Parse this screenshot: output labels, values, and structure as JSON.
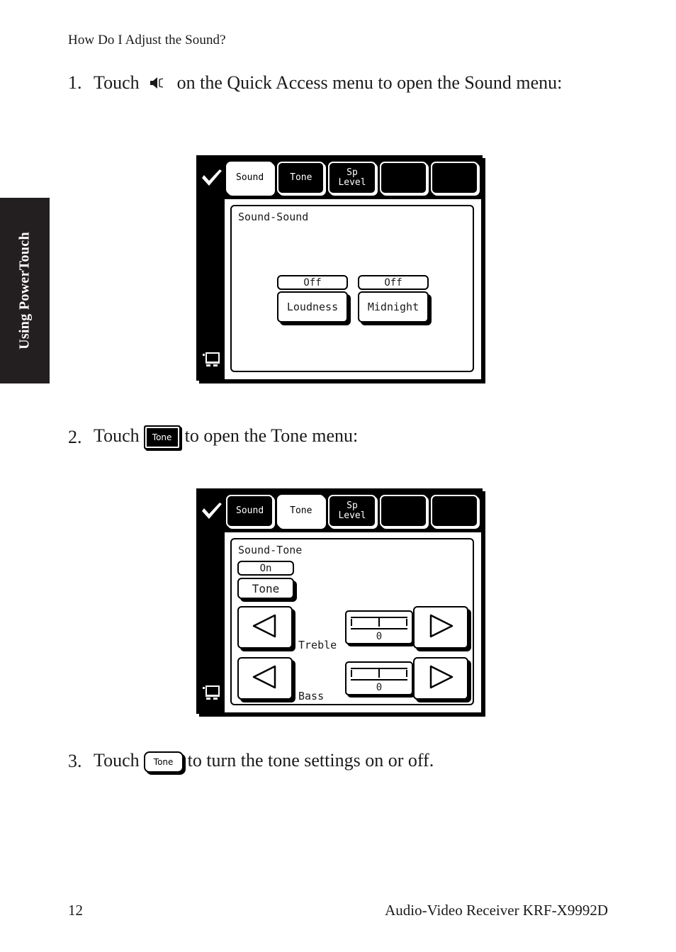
{
  "side_tab": {
    "label": "Using PowerTouch"
  },
  "page_heading": "How Do I Adjust the Sound?",
  "steps": [
    {
      "number": "1.",
      "text_before": "Touch",
      "icon": "speaker-icon",
      "text_after": "on the Quick Access menu to open the Sound menu:"
    },
    {
      "number": "2.",
      "text_before": "Touch",
      "button_label": "Tone",
      "text_after": "to open the Tone menu:"
    },
    {
      "number": "3.",
      "text_before": "Touch",
      "button_label": "Tone",
      "text_after": "to turn the tone settings on or off."
    }
  ],
  "screen_sound": {
    "check_icon": "checkmark-icon",
    "monitor_icon": "monitor-icon",
    "tabs": [
      {
        "label": "Sound",
        "selected": true
      },
      {
        "label": "Tone",
        "selected": false
      },
      {
        "label": "Sp\nLevel",
        "line1": "Sp",
        "line2": "Level",
        "selected": false
      },
      {
        "label": "",
        "selected": false
      },
      {
        "label": "",
        "selected": false
      }
    ],
    "panel_title": "Sound-Sound",
    "controls": [
      {
        "value": "Off",
        "label": "Loudness"
      },
      {
        "value": "Off",
        "label": "Midnight"
      }
    ]
  },
  "screen_tone": {
    "check_icon": "checkmark-icon",
    "monitor_icon": "monitor-icon",
    "tabs": [
      {
        "label": "Sound",
        "selected": false
      },
      {
        "label": "Tone",
        "selected": true
      },
      {
        "label": "Sp\nLevel",
        "line1": "Sp",
        "line2": "Level",
        "selected": false
      },
      {
        "label": "",
        "selected": false
      },
      {
        "label": "",
        "selected": false
      }
    ],
    "panel_title": "Sound-Tone",
    "tone_value": "On",
    "tone_button": "Tone",
    "adjust_rows": [
      {
        "label": "Treble",
        "value": "0",
        "left_icon": "arrow-left-icon",
        "right_icon": "arrow-right-icon"
      },
      {
        "label": "Bass",
        "value": "0",
        "left_icon": "arrow-left-icon",
        "right_icon": "arrow-right-icon"
      }
    ]
  },
  "footer": {
    "page_number": "12",
    "product": "Audio-Video Receiver KRF-X9992D"
  }
}
